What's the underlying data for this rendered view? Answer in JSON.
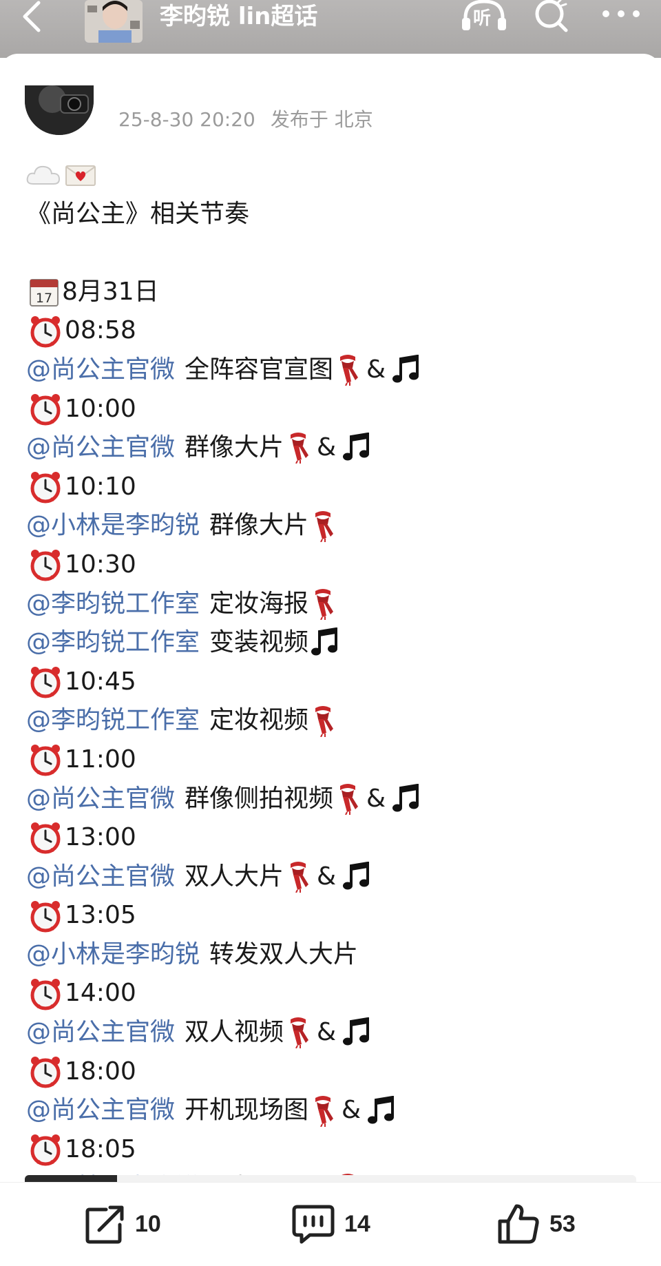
{
  "header": {
    "title": "李昀锐 lin超话",
    "icons": [
      "back-icon",
      "listen-icon",
      "search-icon",
      "more-icon"
    ],
    "listen_label": "听"
  },
  "post": {
    "timestamp": "25-8-30 20:20",
    "location": "发布于 北京",
    "intro_title": "《尚公主》相关节奏",
    "date": "8月31日",
    "schedule": [
      {
        "time": "08:58",
        "items": [
          {
            "mention": "@尚公主官微",
            "text": "全阵容官宣图",
            "scarf": true,
            "music": true
          }
        ]
      },
      {
        "time": "10:00",
        "items": [
          {
            "mention": "@尚公主官微",
            "text": "群像大片",
            "scarf": true,
            "music": true
          }
        ]
      },
      {
        "time": "10:10",
        "items": [
          {
            "mention": "@小林是李昀锐",
            "text": "群像大片",
            "scarf": true,
            "music": false
          }
        ]
      },
      {
        "time": "10:30",
        "items": [
          {
            "mention": "@李昀锐工作室",
            "text": "定妆海报",
            "scarf": true,
            "music": false
          },
          {
            "mention": "@李昀锐工作室",
            "text": "变装视频",
            "scarf": false,
            "music": true
          }
        ]
      },
      {
        "time": "10:45",
        "items": [
          {
            "mention": "@李昀锐工作室",
            "text": "定妆视频",
            "scarf": true,
            "music": false
          }
        ]
      },
      {
        "time": "11:00",
        "items": [
          {
            "mention": "@尚公主官微",
            "text": "群像侧拍视频",
            "scarf": true,
            "music": true
          }
        ]
      },
      {
        "time": "13:00",
        "items": [
          {
            "mention": "@尚公主官微",
            "text": "双人大片",
            "scarf": true,
            "music": true
          }
        ]
      },
      {
        "time": "13:05",
        "items": [
          {
            "mention": "@小林是李昀锐",
            "text": "转发双人大片",
            "scarf": false,
            "music": false
          }
        ]
      },
      {
        "time": "14:00",
        "items": [
          {
            "mention": "@尚公主官微",
            "text": "双人视频",
            "scarf": true,
            "music": true
          }
        ]
      },
      {
        "time": "18:00",
        "items": [
          {
            "mention": "@尚公主官微",
            "text": "开机现场图",
            "scarf": true,
            "music": true
          }
        ]
      },
      {
        "time": "18:05",
        "items": [
          {
            "mention": "@小林是李昀锐",
            "text": "开机现场图",
            "scarf": true,
            "music": false
          }
        ]
      }
    ],
    "amp": "&"
  },
  "actions": {
    "repost_count": "10",
    "comment_count": "14",
    "like_count": "53"
  },
  "colors": {
    "mention": "#4a6ea9",
    "header_bg": "#b1afae",
    "scarf": "#c8282a"
  }
}
